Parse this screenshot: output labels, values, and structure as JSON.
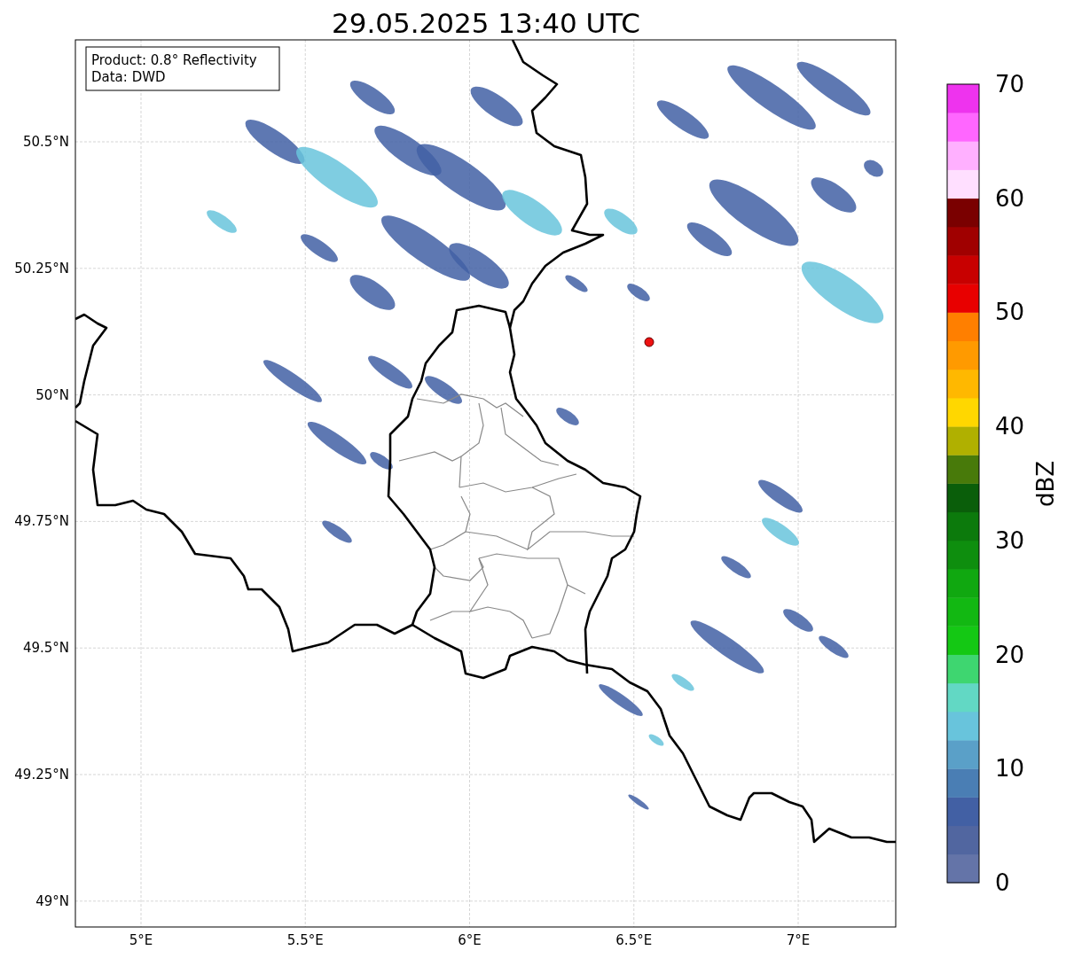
{
  "title": "29.05.2025 13:40 UTC",
  "info_box": [
    "Product: 0.8° Reflectivity",
    "Data: DWD"
  ],
  "y_ticks": [
    "50.5°N",
    "50.25°N",
    "50°N",
    "49.75°N",
    "49.5°N",
    "49.25°N",
    "49°N"
  ],
  "x_ticks": [
    "5°E",
    "5.5°E",
    "6°E",
    "6.5°E",
    "7°E"
  ],
  "colorbar": {
    "label": "dBZ",
    "ticks": [
      "70",
      "60",
      "50",
      "40",
      "30",
      "20",
      "10",
      "0"
    ],
    "segments": [
      {
        "color": "#6474a8"
      },
      {
        "color": "#5166a0"
      },
      {
        "color": "#4260a4"
      },
      {
        "color": "#4a7eb4"
      },
      {
        "color": "#5aa0c8"
      },
      {
        "color": "#68c4dc"
      },
      {
        "color": "#62d8c4"
      },
      {
        "color": "#3ed670"
      },
      {
        "color": "#14c814"
      },
      {
        "color": "#12b812"
      },
      {
        "color": "#10a810"
      },
      {
        "color": "#0e8e0e"
      },
      {
        "color": "#0c7a0c"
      },
      {
        "color": "#0a5e0a"
      },
      {
        "color": "#487a0a"
      },
      {
        "color": "#b0b000"
      },
      {
        "color": "#ffd700"
      },
      {
        "color": "#ffb800"
      },
      {
        "color": "#ff9a00"
      },
      {
        "color": "#ff7f00"
      },
      {
        "color": "#e80000"
      },
      {
        "color": "#c80000"
      },
      {
        "color": "#a00000"
      },
      {
        "color": "#7a0000"
      },
      {
        "color": "#ffdfff"
      },
      {
        "color": "#ffb0ff"
      },
      {
        "color": "#ff66ff"
      },
      {
        "color": "#ee33ee"
      }
    ]
  }
}
